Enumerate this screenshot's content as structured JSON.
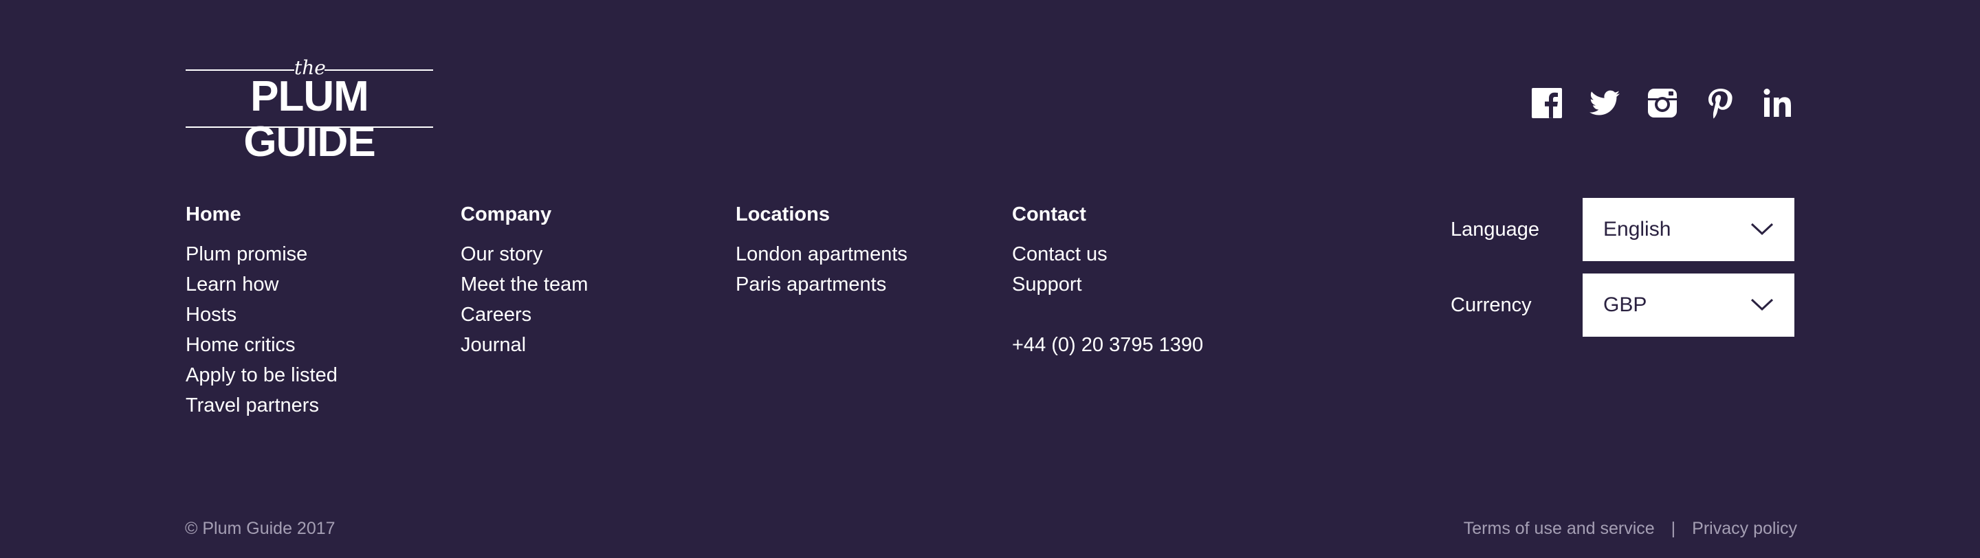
{
  "logo": {
    "the": "the",
    "name": "PLUM GUIDE"
  },
  "social": {
    "icons": [
      "facebook-icon",
      "twitter-icon",
      "instagram-icon",
      "pinterest-icon",
      "linkedin-icon"
    ]
  },
  "columns": {
    "home": {
      "title": "Home",
      "links": [
        "Plum promise",
        "Learn how",
        "Hosts",
        "Home critics",
        "Apply to be listed",
        "Travel partners"
      ]
    },
    "company": {
      "title": "Company",
      "links": [
        "Our story",
        "Meet the team",
        "Careers",
        "Journal"
      ]
    },
    "locations": {
      "title": "Locations",
      "links": [
        "London apartments",
        "Paris apartments"
      ]
    },
    "contact": {
      "title": "Contact",
      "links": [
        "Contact us",
        "Support"
      ],
      "phone": "+44 (0) 20 3795 1390"
    }
  },
  "selectors": {
    "language": {
      "label": "Language",
      "value": "English"
    },
    "currency": {
      "label": "Currency",
      "value": "GBP"
    }
  },
  "bottom": {
    "copyright": "© Plum Guide 2017",
    "terms": "Terms of use and service",
    "separator": "|",
    "privacy": "Privacy policy"
  },
  "colors": {
    "background": "#2a2140",
    "text": "#ffffff",
    "muted": "#a59fb4",
    "select_bg": "#ffffff"
  }
}
